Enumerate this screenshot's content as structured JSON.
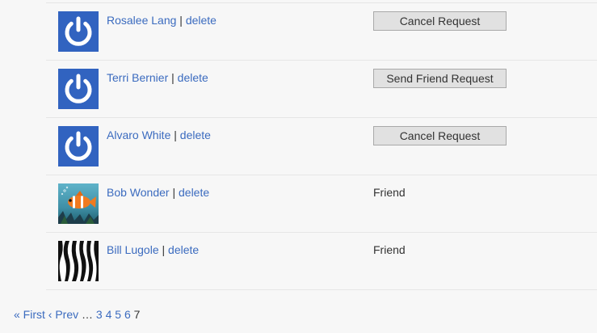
{
  "colors": {
    "link": "#3b6bbf",
    "avatar_default_bg": "#3163c0",
    "button_bg": "#e1e1e1",
    "divider": "#e6e6e6"
  },
  "delete_label": "delete",
  "separator": "|",
  "rows": [
    {
      "name": "Rosalee Lang",
      "avatar": "power-default-avatar",
      "action_type": "button",
      "action_label": "Cancel Request"
    },
    {
      "name": "Terri Bernier",
      "avatar": "power-default-avatar",
      "action_type": "button",
      "action_label": "Send Friend Request"
    },
    {
      "name": "Alvaro White",
      "avatar": "power-default-avatar",
      "action_type": "button",
      "action_label": "Cancel Request"
    },
    {
      "name": "Bob Wonder",
      "avatar": "clownfish-photo-avatar",
      "action_type": "status",
      "action_label": "Friend"
    },
    {
      "name": "Bill Lugole",
      "avatar": "zebra-stripes-avatar",
      "action_type": "status",
      "action_label": "Friend"
    }
  ],
  "pager": {
    "first": "« First",
    "prev": "‹ Prev",
    "ellipsis": "…",
    "pages": [
      "3",
      "4",
      "5",
      "6"
    ],
    "current": "7"
  }
}
